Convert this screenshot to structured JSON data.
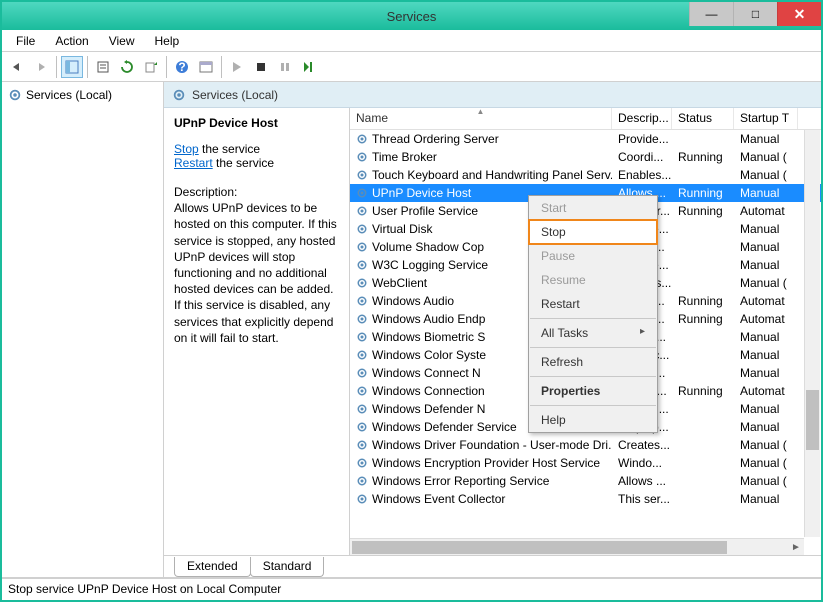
{
  "window": {
    "title": "Services"
  },
  "menu": {
    "file": "File",
    "action": "Action",
    "view": "View",
    "help": "Help"
  },
  "tree": {
    "root": "Services (Local)"
  },
  "pane": {
    "header": "Services (Local)"
  },
  "details": {
    "title": "UPnP Device Host",
    "stop_link": "Stop",
    "stop_suffix": " the service",
    "restart_link": "Restart",
    "restart_suffix": " the service",
    "desc_label": "Description:",
    "desc_body": "Allows UPnP devices to be hosted on this computer. If this service is stopped, any hosted UPnP devices will stop functioning and no additional hosted devices can be added. If this service is disabled, any services that explicitly depend on it will fail to start."
  },
  "columns": {
    "name": "Name",
    "description": "Descrip...",
    "status": "Status",
    "startup": "Startup T"
  },
  "services": [
    {
      "name": "Thread Ordering Server",
      "desc": "Provide...",
      "status": "",
      "startup": "Manual"
    },
    {
      "name": "Time Broker",
      "desc": "Coordi...",
      "status": "Running",
      "startup": "Manual ("
    },
    {
      "name": "Touch Keyboard and Handwriting Panel Serv...",
      "desc": "Enables...",
      "status": "",
      "startup": "Manual ("
    },
    {
      "name": "UPnP Device Host",
      "desc": "Allows ...",
      "status": "Running",
      "startup": "Manual",
      "selected": true
    },
    {
      "name": "User Profile Service",
      "desc": "This ser...",
      "status": "Running",
      "startup": "Automat"
    },
    {
      "name": "Virtual Disk",
      "desc": "Provide...",
      "status": "",
      "startup": "Manual"
    },
    {
      "name": "Volume Shadow Cop",
      "desc": "Manag...",
      "status": "",
      "startup": "Manual"
    },
    {
      "name": "W3C Logging Service",
      "desc": "Provide...",
      "status": "",
      "startup": "Manual"
    },
    {
      "name": "WebClient",
      "desc": "Enables...",
      "status": "",
      "startup": "Manual ("
    },
    {
      "name": "Windows Audio",
      "desc": "Manag...",
      "status": "Running",
      "startup": "Automat"
    },
    {
      "name": "Windows Audio Endp",
      "desc": "Manag...",
      "status": "Running",
      "startup": "Automat"
    },
    {
      "name": "Windows Biometric S",
      "desc": "The Wi...",
      "status": "",
      "startup": "Manual"
    },
    {
      "name": "Windows Color Syste",
      "desc": "The Wc...",
      "status": "",
      "startup": "Manual"
    },
    {
      "name": "Windows Connect N",
      "desc": "WCNC...",
      "status": "",
      "startup": "Manual"
    },
    {
      "name": "Windows Connection",
      "desc": "Makes ...",
      "status": "Running",
      "startup": "Automat"
    },
    {
      "name": "Windows Defender N",
      "desc": "Helps g...",
      "status": "",
      "startup": "Manual"
    },
    {
      "name": "Windows Defender Service",
      "desc": "Helps p...",
      "status": "",
      "startup": "Manual"
    },
    {
      "name": "Windows Driver Foundation - User-mode Dri...",
      "desc": "Creates...",
      "status": "",
      "startup": "Manual ("
    },
    {
      "name": "Windows Encryption Provider Host Service",
      "desc": "Windo...",
      "status": "",
      "startup": "Manual ("
    },
    {
      "name": "Windows Error Reporting Service",
      "desc": "Allows ...",
      "status": "",
      "startup": "Manual ("
    },
    {
      "name": "Windows Event Collector",
      "desc": "This ser...",
      "status": "",
      "startup": "Manual"
    }
  ],
  "context_menu": {
    "start": "Start",
    "stop": "Stop",
    "pause": "Pause",
    "resume": "Resume",
    "restart": "Restart",
    "all_tasks": "All Tasks",
    "refresh": "Refresh",
    "properties": "Properties",
    "help": "Help"
  },
  "tabs": {
    "extended": "Extended",
    "standard": "Standard"
  },
  "statusbar": {
    "text": "Stop service UPnP Device Host on Local Computer"
  }
}
